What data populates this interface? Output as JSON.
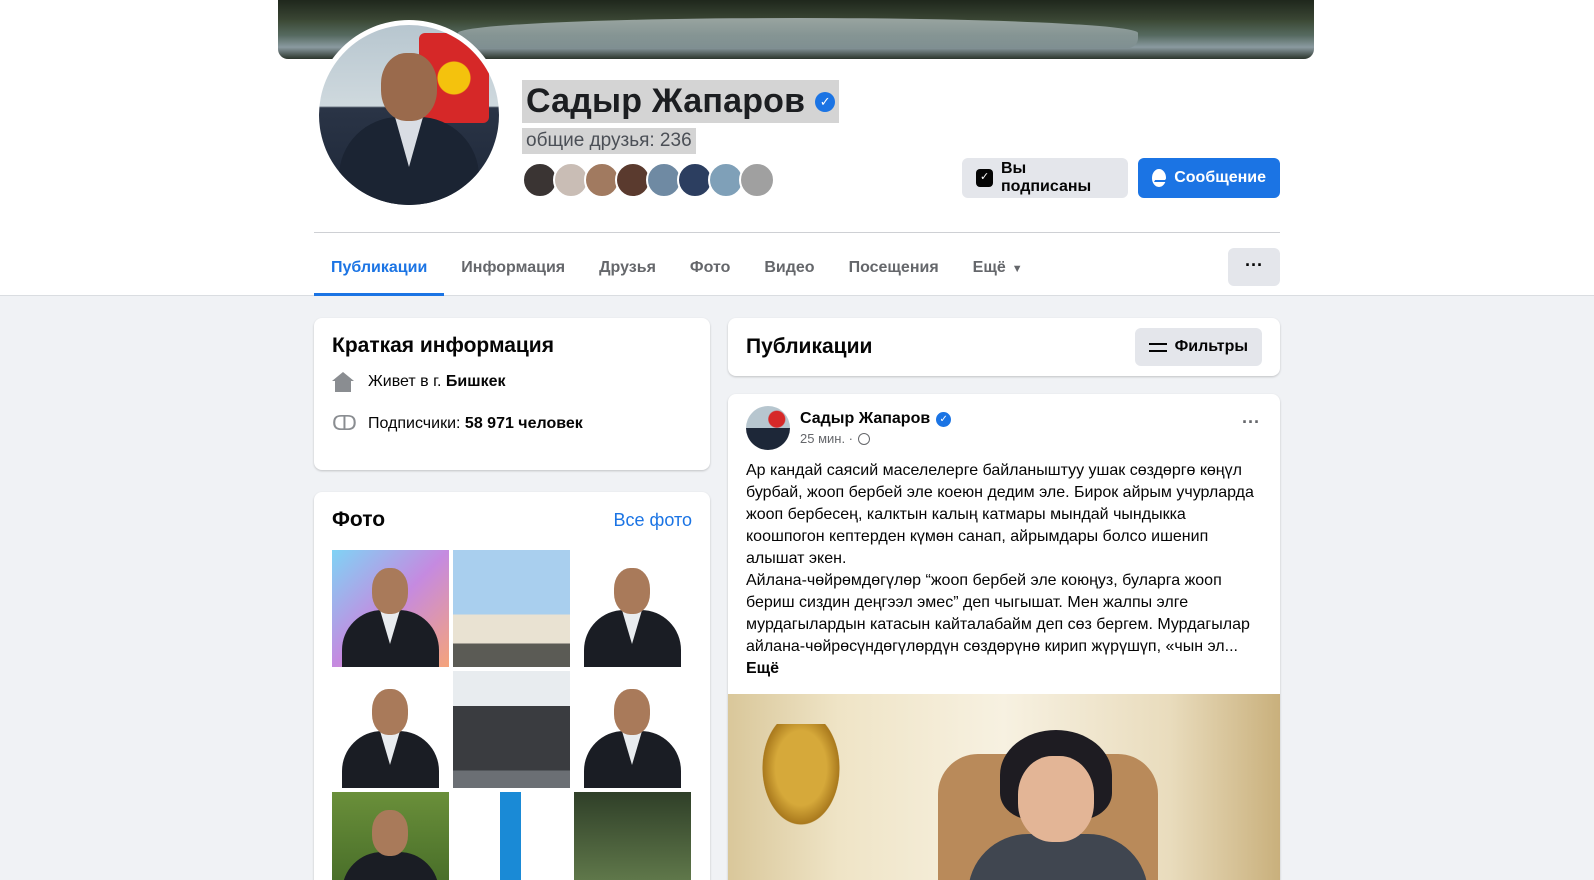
{
  "profile": {
    "name": "Садыр Жапаров",
    "mutual_friends": "общие друзья: 236",
    "verified": true
  },
  "actions": {
    "subscribed_label": "Вы подписаны",
    "message_label": "Сообщение",
    "more_label": "···"
  },
  "tabs": [
    {
      "label": "Публикации",
      "active": true
    },
    {
      "label": "Информация"
    },
    {
      "label": "Друзья"
    },
    {
      "label": "Фото"
    },
    {
      "label": "Видео"
    },
    {
      "label": "Посещения"
    },
    {
      "label": "Ещё",
      "dropdown": true
    }
  ],
  "intro": {
    "title": "Краткая информация",
    "lives_prefix": "Живет в г.",
    "lives_city": "Бишкек",
    "followers_prefix": "Подписчики:",
    "followers_value": "58 971 человек"
  },
  "photos": {
    "title": "Фото",
    "all_link": "Все фото"
  },
  "posts_section": {
    "title": "Публикации",
    "filter_label": "Фильтры"
  },
  "post": {
    "author": "Садыр Жапаров",
    "time": "25 мин. ·",
    "paragraph1": "Ар кандай саясий маселелерге байланыштуу ушак сөздөргө көңүл бурбай, жооп бербей эле коеюн дедим эле. Бирок айрым учурларда жооп бербесең, калктын калың катмары мындай чындыкка коошпогон кептерден күмөн санап, айрымдары болсо ишенип алышат экен.",
    "paragraph2": "Айлана-чөйрөмдөгүлөр “жооп бербей эле коюңуз, буларга жооп бериш сиздин деңгээл эмес” деп чыгышат. Мен жалпы элге мурдагылардын катасын кайталабайм деп сөз бергем. Мурдагылар айлана-чөйрөсүндөгүлөрдүн сөздөрүнө кирип жүрүшүп, «чын эл...",
    "see_more": "Ещё",
    "more_label": "···"
  },
  "colors": {
    "accent": "#1b74e4",
    "background": "#f0f2f5",
    "secondary_button": "#e4e6eb"
  }
}
